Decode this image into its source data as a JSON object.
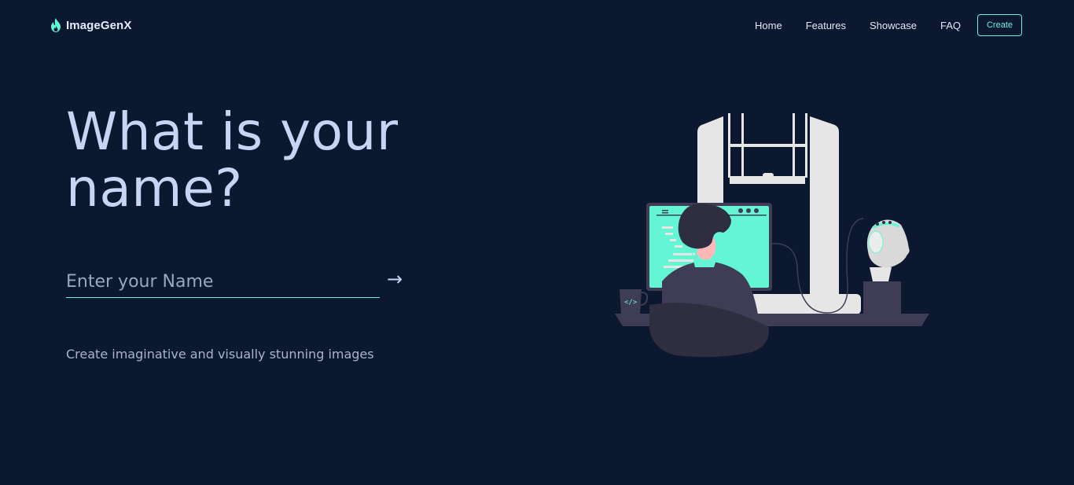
{
  "brand": {
    "name": "ImageGenX",
    "icon": "flame-icon",
    "accent": "#64f5d5"
  },
  "nav": {
    "links": [
      "Home",
      "Features",
      "Showcase",
      "FAQ"
    ],
    "create_label": "Create"
  },
  "hero": {
    "title": "What is your name?",
    "input_placeholder": "Enter your Name",
    "input_value": "",
    "submit_icon": "arrow-right-icon",
    "submit_glyph": "→",
    "tagline": "Create imaginative and visually stunning images"
  },
  "illustration": {
    "subject": "illustration-person-at-computer",
    "colors": {
      "screen": "#64f5d5",
      "frame": "#e6e6e6",
      "dark": "#3f3d56",
      "background": "#0b1830"
    }
  }
}
